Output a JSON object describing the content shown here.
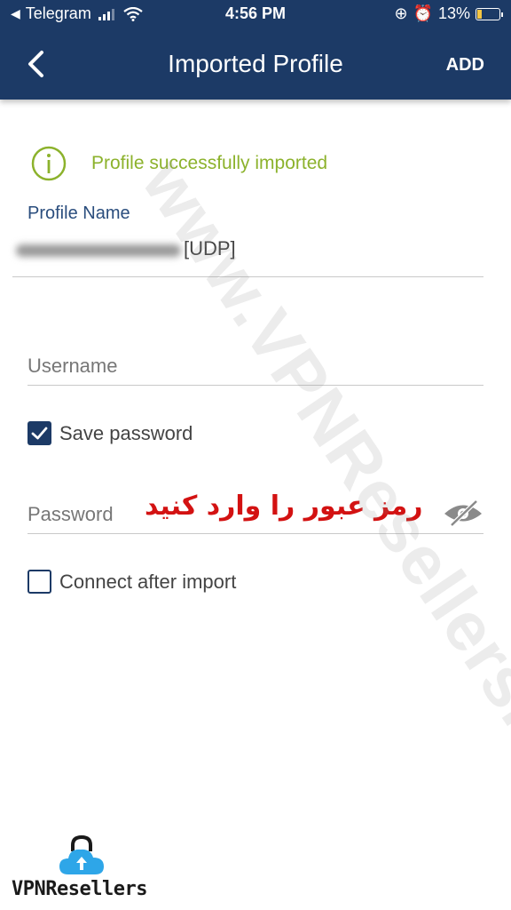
{
  "status_bar": {
    "app_back_label": "Telegram",
    "time": "4:56 PM",
    "battery": "13%"
  },
  "nav": {
    "title": "Imported Profile",
    "add_label": "ADD"
  },
  "success_message": "Profile successfully imported",
  "profile": {
    "label": "Profile Name",
    "value": "[UDP]"
  },
  "username": {
    "placeholder": "Username",
    "value": ""
  },
  "save_password": {
    "label": "Save password",
    "checked": true
  },
  "password": {
    "placeholder": "Password",
    "hint": "رمز عبور را وارد کنید"
  },
  "connect_after_import": {
    "label": "Connect after import",
    "checked": false
  },
  "watermark": "www.VPNResellers.me",
  "logo_text": "VPNResellers",
  "colors": {
    "header": "#1c3a66",
    "success": "#8cb22c",
    "label": "#2a4d7d",
    "hint": "#d31212"
  },
  "icons": [
    "back-arrow-icon",
    "info-icon",
    "eye-off-icon",
    "check-icon",
    "lock-cloud-icon",
    "wifi-icon",
    "signal-icon",
    "battery-icon"
  ]
}
